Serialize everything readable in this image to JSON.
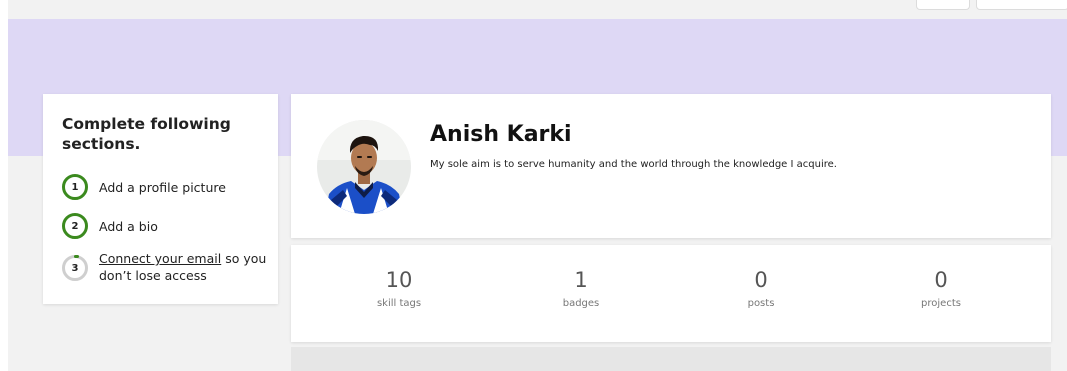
{
  "sidebar": {
    "title": "Complete following sections.",
    "steps": [
      {
        "number": "1",
        "label": "Add a profile picture",
        "status": "complete"
      },
      {
        "number": "2",
        "label": "Add a bio",
        "status": "complete"
      },
      {
        "number": "3",
        "link_text": "Connect your email",
        "rest_text": " so you don’t lose access",
        "status": "incomplete"
      }
    ]
  },
  "profile": {
    "name": "Anish Karki",
    "bio": "My sole aim is to serve humanity and the world through the knowledge I acquire."
  },
  "stats": [
    {
      "value": "10",
      "label": "skill tags"
    },
    {
      "value": "1",
      "label": "badges"
    },
    {
      "value": "0",
      "label": "posts"
    },
    {
      "value": "0",
      "label": "projects"
    }
  ],
  "colors": {
    "banner": "#ded8f5",
    "progress_complete": "#3b8a1e",
    "progress_incomplete": "#cfcfcf",
    "page_background": "#f2f2f2"
  }
}
